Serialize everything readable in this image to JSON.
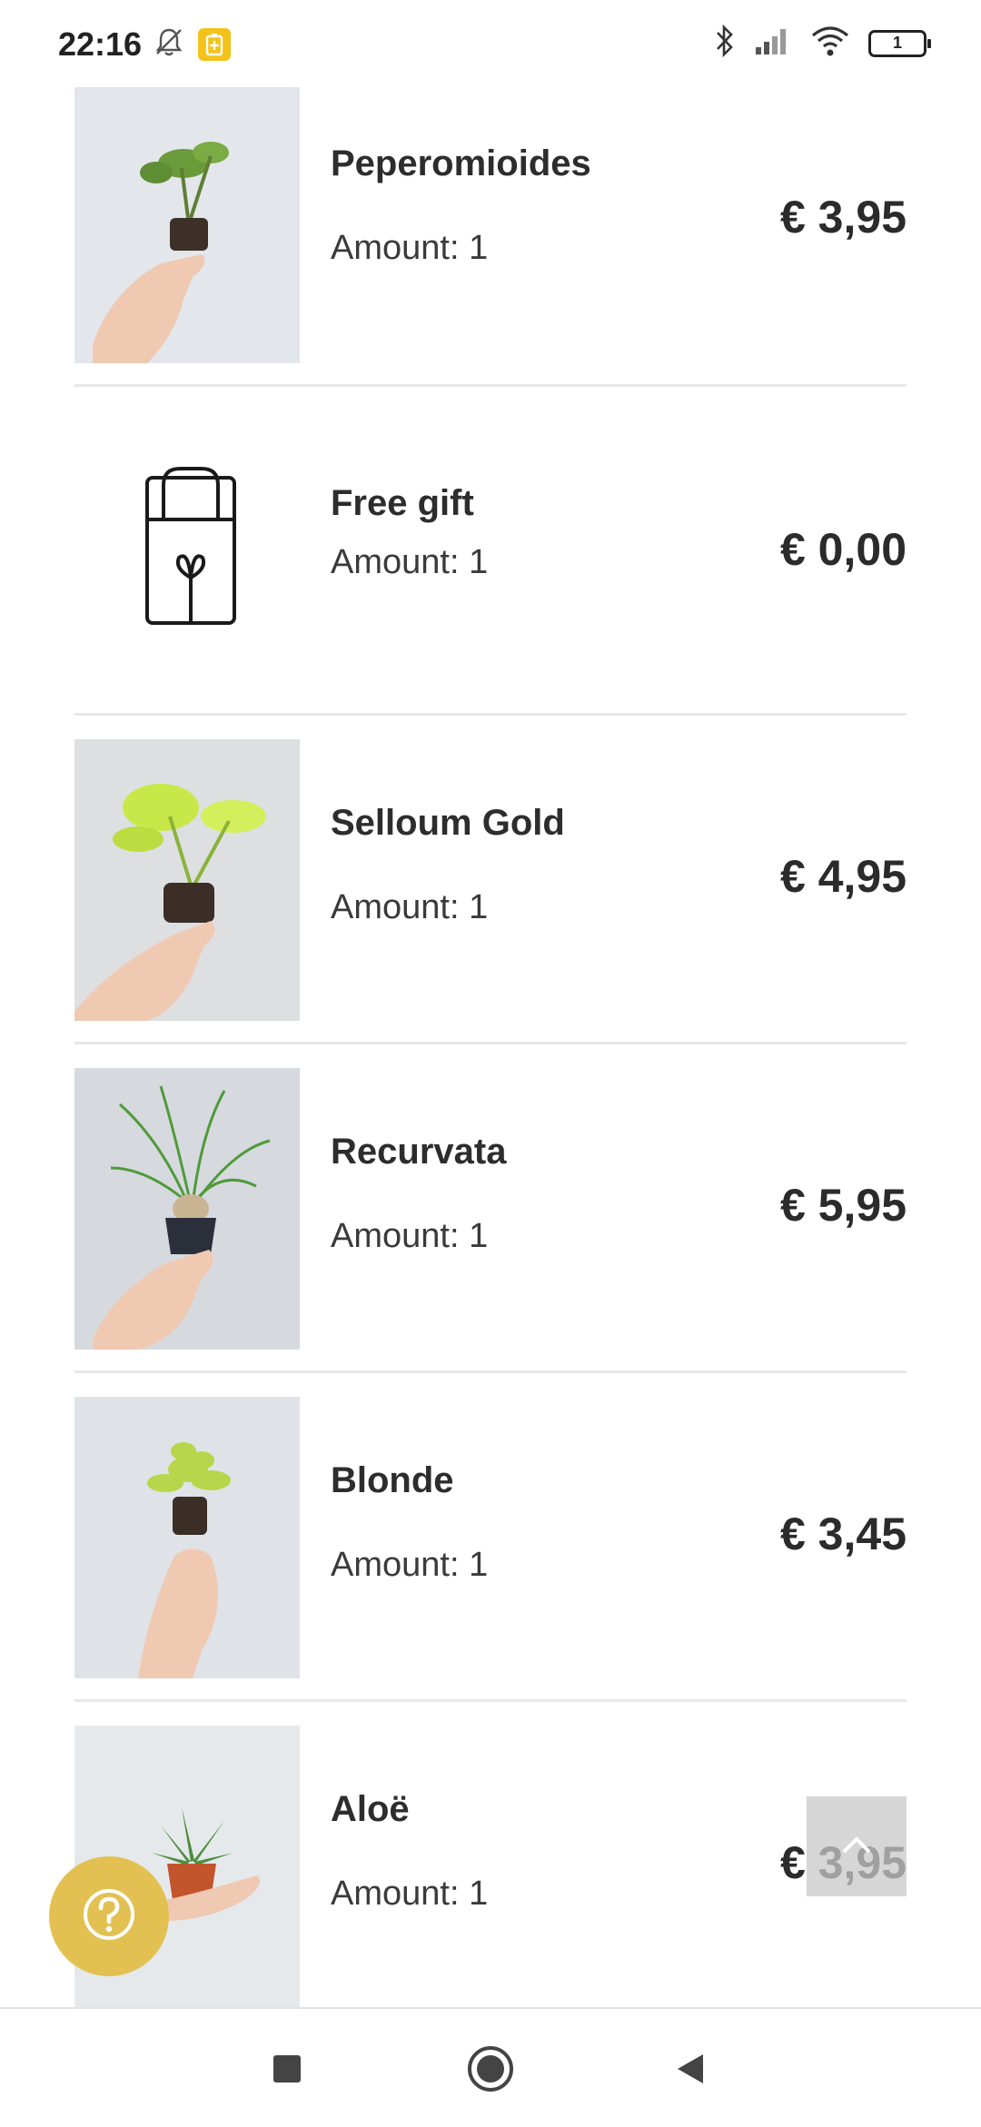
{
  "status_bar": {
    "time": "22:16",
    "battery_level": "1",
    "icons": [
      "bell-off-icon",
      "battery-saver-icon",
      "bluetooth-icon",
      "signal-icon",
      "wifi-icon",
      "battery-icon"
    ]
  },
  "cart": {
    "items": [
      {
        "name": "Peperomioides",
        "amount": "Amount: 1",
        "price": "€ 3,95",
        "image": "plant-peperomioides"
      },
      {
        "name": "Free gift",
        "amount": "Amount: 1",
        "price": "€ 0,00",
        "image": "gift-bag-icon"
      },
      {
        "name": "Selloum Gold",
        "amount": "Amount: 1",
        "price": "€ 4,95",
        "image": "plant-selloum-gold"
      },
      {
        "name": "Recurvata",
        "amount": "Amount: 1",
        "price": "€ 5,95",
        "image": "plant-recurvata"
      },
      {
        "name": "Blonde",
        "amount": "Amount: 1",
        "price": "€ 3,45",
        "image": "plant-blonde"
      },
      {
        "name": "Aloë",
        "amount": "Amount: 1",
        "price": "€ 3,95",
        "image": "plant-aloe"
      }
    ]
  },
  "controls": {
    "help_icon": "help-icon",
    "scroll_top_icon": "chevron-up-icon"
  },
  "nav_bar": {
    "icons": [
      "recents-icon",
      "home-icon",
      "back-icon"
    ]
  },
  "colors": {
    "accent": "#e2c152",
    "battery_saver": "#f4c21b",
    "divider": "#e7e7e7"
  }
}
